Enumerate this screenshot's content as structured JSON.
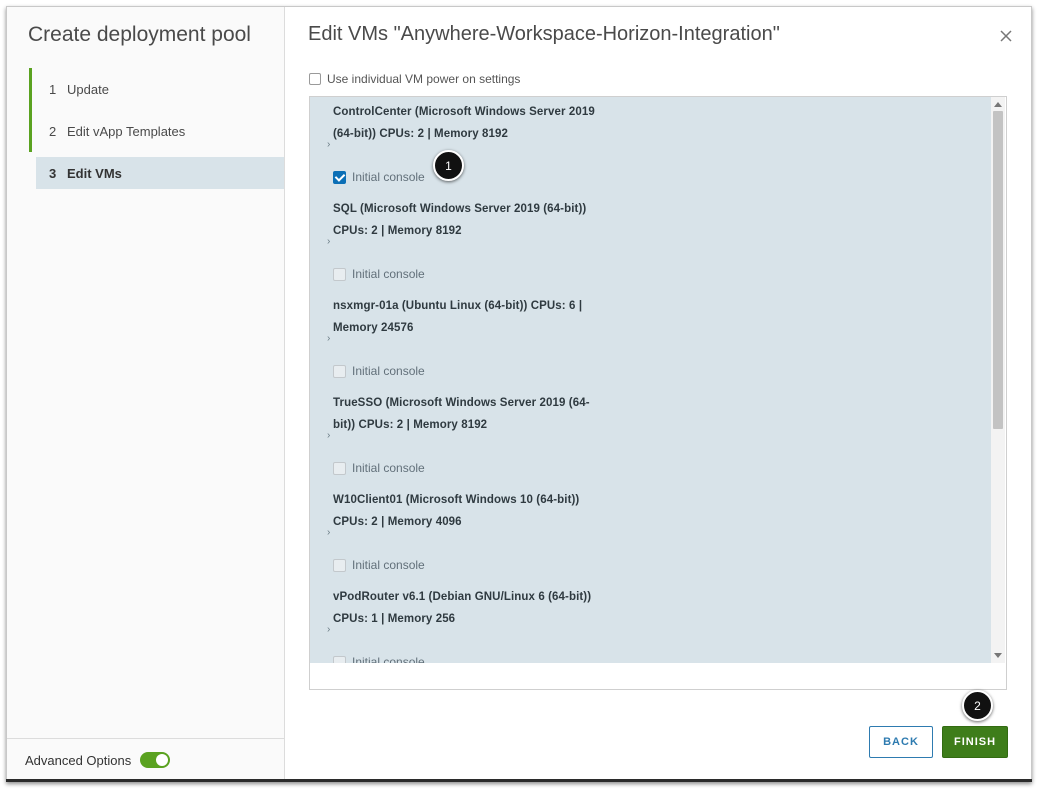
{
  "sidebar": {
    "title": "Create deployment pool",
    "steps": [
      {
        "num": "1",
        "label": "Update"
      },
      {
        "num": "2",
        "label": "Edit vApp Templates"
      },
      {
        "num": "3",
        "label": "Edit VMs"
      }
    ],
    "advanced_label": "Advanced Options"
  },
  "main": {
    "title": "Edit VMs \"Anywhere-Workspace-Horizon-Integration\"",
    "power_label": "Use individual VM power on settings",
    "vms": [
      {
        "line1": "ControlCenter (Microsoft Windows Server 2019",
        "line2": "(64-bit)) CPUs: 2 | Memory 8192",
        "console_label": "Initial console",
        "console_checked": true
      },
      {
        "line1": "SQL (Microsoft Windows Server 2019 (64-bit))",
        "line2": "CPUs: 2 | Memory 8192",
        "console_label": "Initial console",
        "console_checked": false
      },
      {
        "line1": "nsxmgr-01a (Ubuntu Linux (64-bit)) CPUs: 6 |",
        "line2": "Memory 24576",
        "console_label": "Initial console",
        "console_checked": false
      },
      {
        "line1": "TrueSSO (Microsoft Windows Server 2019 (64-",
        "line2": "bit)) CPUs: 2 | Memory 8192",
        "console_label": "Initial console",
        "console_checked": false
      },
      {
        "line1": "W10Client01 (Microsoft Windows 10 (64-bit))",
        "line2": "CPUs: 2 | Memory 4096",
        "console_label": "Initial console",
        "console_checked": false
      },
      {
        "line1": "vPodRouter v6.1 (Debian GNU/Linux 6 (64-bit))",
        "line2": "CPUs: 1 | Memory 256",
        "console_label": "Initial console",
        "console_checked": false
      }
    ]
  },
  "buttons": {
    "back": "BACK",
    "finish": "FINISH"
  },
  "markers": [
    "1",
    "2"
  ],
  "icons": {
    "close": "close-icon",
    "expand": "chevron-right-icon"
  },
  "colors": {
    "accent_green": "#5aa220",
    "finish_bg": "#3e7d1a",
    "list_bg": "#d8e3e9",
    "back_border": "#2e7bb0"
  }
}
